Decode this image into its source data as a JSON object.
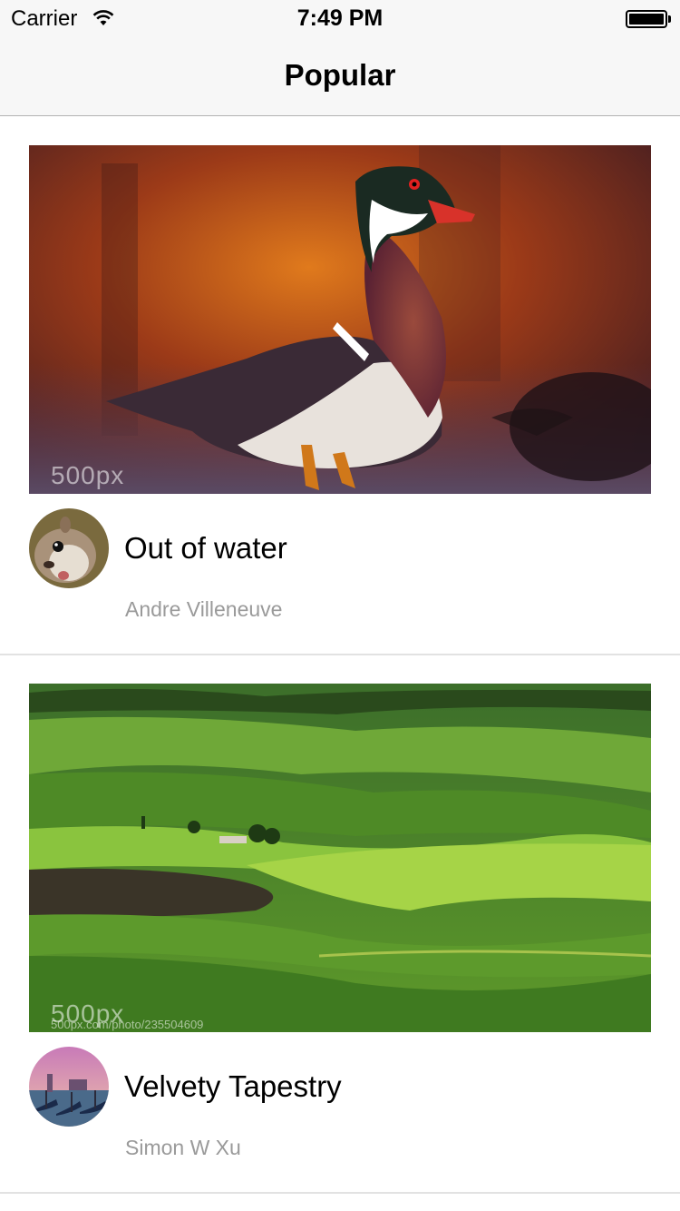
{
  "status_bar": {
    "carrier": "Carrier",
    "time": "7:49 PM",
    "wifi_icon": "wifi-icon",
    "battery_icon": "battery-icon",
    "battery_level": 1.0
  },
  "nav": {
    "title": "Popular"
  },
  "feed": [
    {
      "title": "Out of water",
      "author": "Andre Villeneuve",
      "watermark": "500px",
      "watermark_url": "",
      "photo_subject": "wood duck",
      "avatar_subject": "squirrel"
    },
    {
      "title": "Velvety Tapestry",
      "author": "Simon W Xu",
      "watermark": "500px",
      "watermark_url": "500px.com/photo/235504609",
      "photo_subject": "green rolling hills",
      "avatar_subject": "venice gondolas"
    }
  ],
  "colors": {
    "bar_background": "#f7f7f7",
    "separator": "#e2e2e2",
    "author_text": "#9a9a9a"
  }
}
